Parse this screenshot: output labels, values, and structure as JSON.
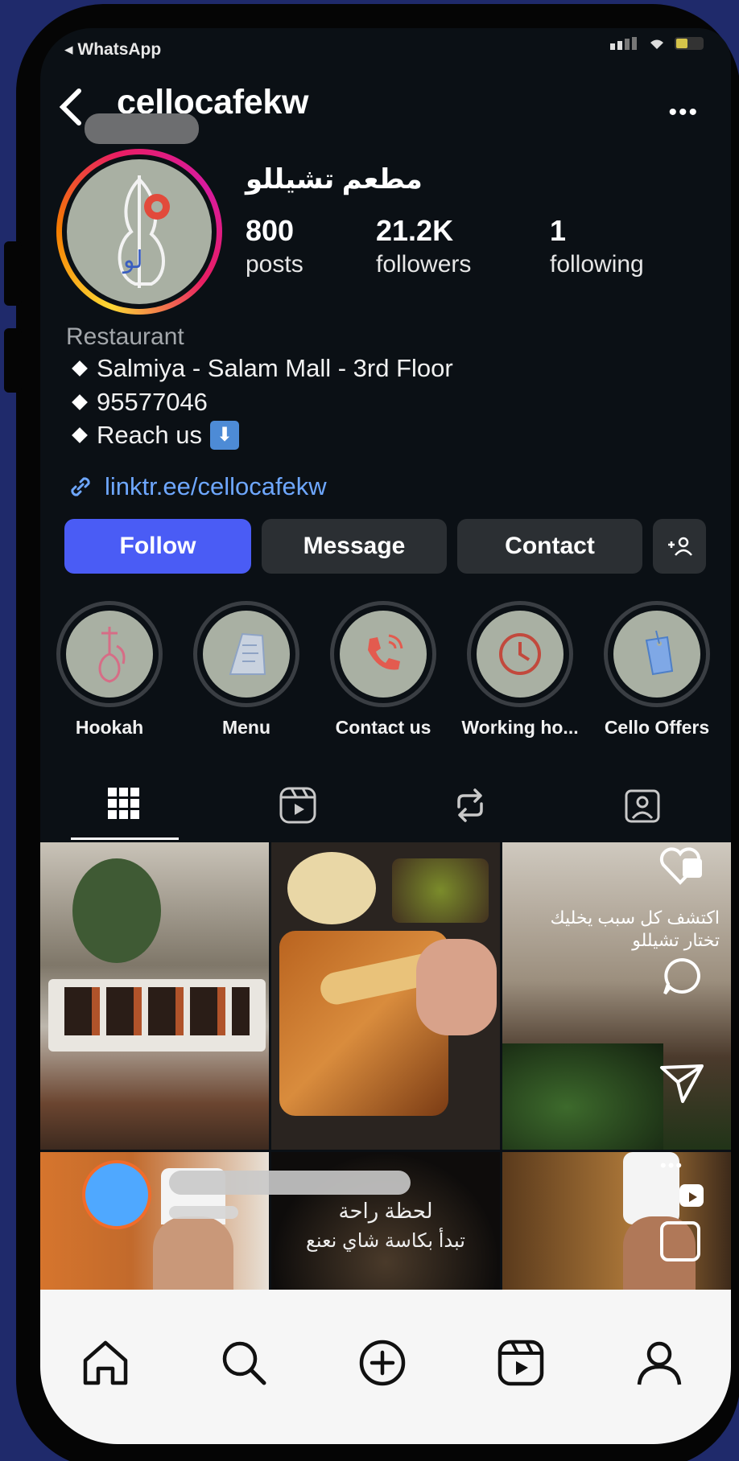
{
  "status": {
    "back_app": "WhatsApp"
  },
  "header": {
    "username": "cellocafekw"
  },
  "profile": {
    "name": "مطعم تشيللو",
    "stats": [
      {
        "value": "800",
        "label": "posts"
      },
      {
        "value": "21.2K",
        "label": "followers"
      },
      {
        "value": "1",
        "label": "following"
      }
    ],
    "category": "Restaurant",
    "bio_lines": [
      "Salmiya - Salam Mall - 3rd Floor",
      "95577046",
      "Reach us"
    ],
    "link": "linktr.ee/cellocafekw"
  },
  "actions": {
    "follow": "Follow",
    "message": "Message",
    "contact": "Contact"
  },
  "highlights": [
    {
      "label": "Hookah",
      "icon": "hookah-icon"
    },
    {
      "label": "Menu",
      "icon": "menu-card-icon"
    },
    {
      "label": "Contact us",
      "icon": "phone-icon"
    },
    {
      "label": "Working ho...",
      "icon": "clock-icon"
    },
    {
      "label": "Cello Offers",
      "icon": "tag-icon"
    }
  ],
  "posts": {
    "overlay_text_1": "اكتشف كل سبب يخليك تختار تشيللو",
    "overlay_text_2_line1": "لحظة راحة",
    "overlay_text_2_line2": "تبدأ بكاسة شاي نعنع"
  },
  "colors": {
    "follow": "#4a5cf5",
    "link": "#6ea7ff",
    "frame": "#1f2a6b"
  }
}
